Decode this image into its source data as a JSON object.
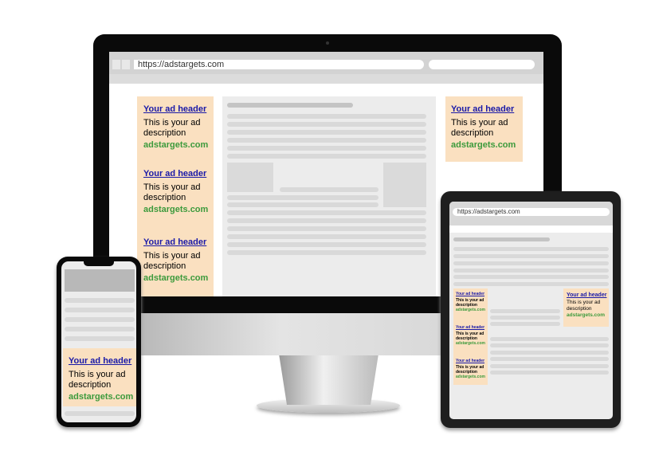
{
  "desktop": {
    "url": "https://adstargets.com",
    "left_ads": [
      {
        "header": "Your ad header",
        "description": "This is your ad description",
        "domain": "adstargets.com"
      },
      {
        "header": "Your ad header",
        "description": "This is your ad description",
        "domain": "adstargets.com"
      },
      {
        "header": "Your ad header",
        "description": "This is your ad description",
        "domain": "adstargets.com"
      }
    ],
    "right_ad": {
      "header": "Your ad header",
      "description": "This is your ad description",
      "domain": "adstargets.com"
    }
  },
  "tablet": {
    "url": "https://adstargets.com",
    "left_ads": [
      {
        "header": "Your ad header",
        "description": "This is your ad description",
        "domain": "adstargets.com"
      },
      {
        "header": "Your ad header",
        "description": "This is your ad description",
        "domain": "adstargets.com"
      },
      {
        "header": "Your ad header",
        "description": "This is your ad description",
        "domain": "adstargets.com"
      }
    ],
    "right_ad": {
      "header": "Your ad header",
      "description": "This is your ad description",
      "domain": "adstargets.com"
    }
  },
  "phone": {
    "ad": {
      "header": "Your ad header",
      "description": "This is your ad description",
      "domain": "adstargets.com"
    }
  },
  "colors": {
    "ad_bg": "#fae0c0",
    "link": "#1a1aa8",
    "domain": "#3c9a3c",
    "bezel": "#0a0a0a"
  }
}
